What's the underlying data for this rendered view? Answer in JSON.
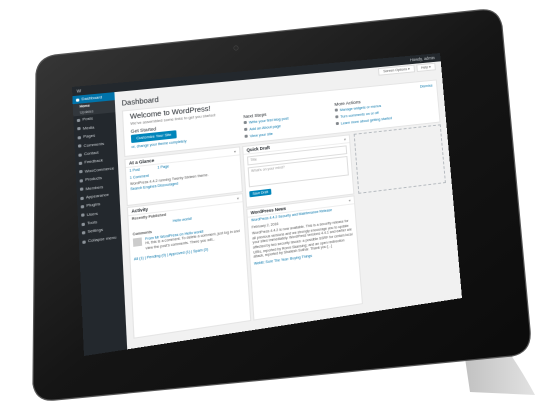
{
  "adminbar": {
    "greeting": "Howdy, admin",
    "screen_options": "Screen Options ▾",
    "help": "Help ▾"
  },
  "sidebar": {
    "items": [
      {
        "label": "Dashboard",
        "active": true
      },
      {
        "label": "Posts"
      },
      {
        "label": "Media"
      },
      {
        "label": "Pages"
      },
      {
        "label": "Comments"
      },
      {
        "label": "Contact"
      },
      {
        "label": "Feedback"
      },
      {
        "label": "WooCommerce"
      },
      {
        "label": "Products"
      },
      {
        "label": "Members"
      },
      {
        "label": "Appearance"
      },
      {
        "label": "Plugins"
      },
      {
        "label": "Users"
      },
      {
        "label": "Tools"
      },
      {
        "label": "Settings"
      },
      {
        "label": "Collapse menu"
      }
    ],
    "submenu": [
      "Home",
      "Updates"
    ]
  },
  "page": {
    "title": "Dashboard",
    "dismiss": "Dismiss"
  },
  "welcome": {
    "title": "Welcome to WordPress!",
    "subtitle": "We've assembled some links to get you started:",
    "get_started": "Get Started",
    "button": "Customize Your Site",
    "or_link": "or, change your theme completely",
    "next_steps_title": "Next Steps",
    "next_steps": [
      "Write your first blog post",
      "Add an About page",
      "View your site"
    ],
    "more_actions_title": "More Actions",
    "more_actions": [
      "Manage widgets or menus",
      "Turn comments on or off",
      "Learn more about getting started"
    ]
  },
  "at_a_glance": {
    "title": "At a Glance",
    "stats": [
      "1 Post",
      "1 Page",
      "1 Comment"
    ],
    "footer": "WordPress 4.4.2 running Twenty Sixteen theme.",
    "footer2": "Search Engines Discouraged"
  },
  "activity": {
    "title": "Activity",
    "recently": "Recently Published",
    "recent_item": "Hello world!",
    "comments_title": "Comments",
    "comment_from": "From Mr WordPress on Hello world!",
    "comment_text": "Hi, this is a comment. To delete a comment, just log in and view the post's comments. There you will...",
    "filters": "All (1) | Pending (0) | Approved (1) | Spam (0)"
  },
  "quick_draft": {
    "title": "Quick Draft",
    "title_placeholder": "Title",
    "content_placeholder": "What's on your mind?",
    "save_button": "Save Draft"
  },
  "news": {
    "title": "WordPress News",
    "headline": "WordPress 4.4.2 Security and Maintenance Release",
    "date": "February 2, 2016",
    "body": "WordPress 4.4.2 is now available. This is a security release for all previous versions and we strongly encourage you to update your sites immediately. WordPress versions 4.4.1 and earlier are affected by two security issues: a possible SSRF for certain local URIs, reported by Ronni Skansing; and an open redirection attack, reported by Shailesh Suthar. Thank you [...]",
    "footer": "WebB: Sure The Year: Buying Things"
  }
}
